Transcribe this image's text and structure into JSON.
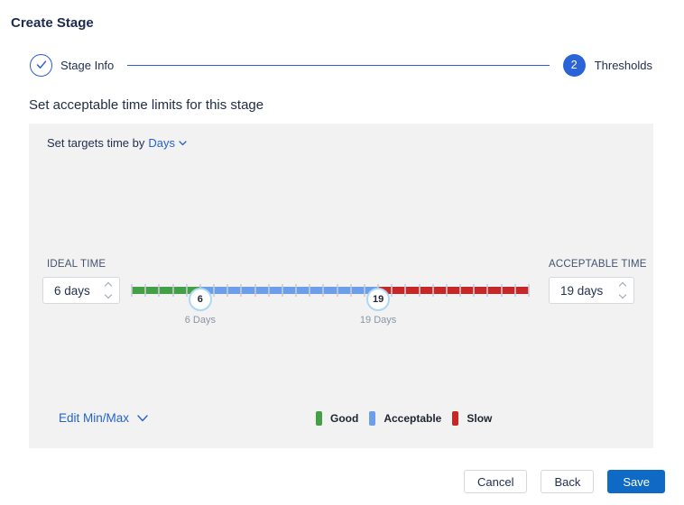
{
  "page": {
    "title": "Create Stage"
  },
  "stepper": {
    "steps": [
      {
        "label": "Stage Info",
        "state": "completed"
      },
      {
        "label": "Thresholds",
        "state": "active",
        "number": "2"
      }
    ]
  },
  "subtitle": "Set acceptable time limits for this stage",
  "panel": {
    "targets_prefix": "Set targets time by",
    "unit_selector": {
      "value": "Days"
    },
    "ideal": {
      "label": "IDEAL TIME",
      "value": "6 days"
    },
    "acceptable": {
      "label": "ACCEPTABLE TIME",
      "value": "19 days"
    },
    "edit_minmax_label": "Edit Min/Max",
    "legend": [
      {
        "label": "Good",
        "color": "#43a047"
      },
      {
        "label": "Acceptable",
        "color": "#6d9eeb"
      },
      {
        "label": "Slow",
        "color": "#c62828"
      }
    ]
  },
  "slider": {
    "min": 1,
    "max": 30,
    "tick_step": 1,
    "ideal": 6,
    "acceptable": 19,
    "ideal_label": "6 Days",
    "acceptable_label": "19 Days",
    "colors": {
      "good": "#43a047",
      "acceptable": "#6d9eeb",
      "slow": "#c62828"
    },
    "handle_ring_color": "#abd9f3"
  },
  "footer": {
    "cancel": "Cancel",
    "back": "Back",
    "save": "Save"
  },
  "accent_colors": {
    "stepper_blue": "#2e5cd6",
    "link_blue": "#2563c9",
    "save_blue": "#0e6ac4"
  }
}
